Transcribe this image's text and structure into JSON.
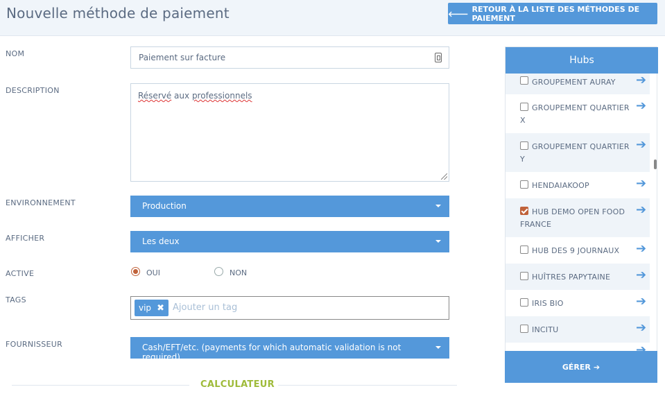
{
  "header": {
    "title": "Nouvelle méthode de paiement",
    "back_button": "RETOUR À LA LISTE DES MÉTHODES DE PAIEMENT"
  },
  "form": {
    "name_label": "NOM",
    "name_value": "Paiement sur facture",
    "description_label": "DESCRIPTION",
    "description_word1": "Réservé",
    "description_word2": " aux ",
    "description_word3": "professionnels",
    "environment_label": "ENVIRONNEMENT",
    "environment_value": "Production",
    "display_label": "AFFICHER",
    "display_value": "Les deux",
    "active_label": "ACTIVE",
    "active_yes": "OUI",
    "active_no": "NON",
    "active_selected": "OUI",
    "tags_label": "TAGS",
    "tags": [
      "vip"
    ],
    "tags_placeholder": "Ajouter un tag",
    "provider_label": "FOURNISSEUR",
    "provider_value": "Cash/EFT/etc. (payments for which automatic validation is not required)",
    "calculator_title": "CALCULATEUR"
  },
  "hubs": {
    "title": "Hubs",
    "items": [
      {
        "name": "GROUPEMENT AURAY",
        "checked": false
      },
      {
        "name": "GROUPEMENT QUARTIER X",
        "checked": false
      },
      {
        "name": "GROUPEMENT QUARTIER Y",
        "checked": false
      },
      {
        "name": "HENDAIAKOOP",
        "checked": false
      },
      {
        "name": "HUB DEMO OPEN FOOD FRANCE",
        "checked": true
      },
      {
        "name": "HUB DES 9 JOURNAUX",
        "checked": false
      },
      {
        "name": "HUÎTRES PAPYTAINE",
        "checked": false
      },
      {
        "name": "IRIS BIO",
        "checked": false
      },
      {
        "name": "INCITU",
        "checked": false
      }
    ],
    "manage_button": "GÉRER"
  },
  "colors": {
    "primary": "#5498da",
    "accent": "#c0623a",
    "calculator": "#9fbb3a"
  }
}
